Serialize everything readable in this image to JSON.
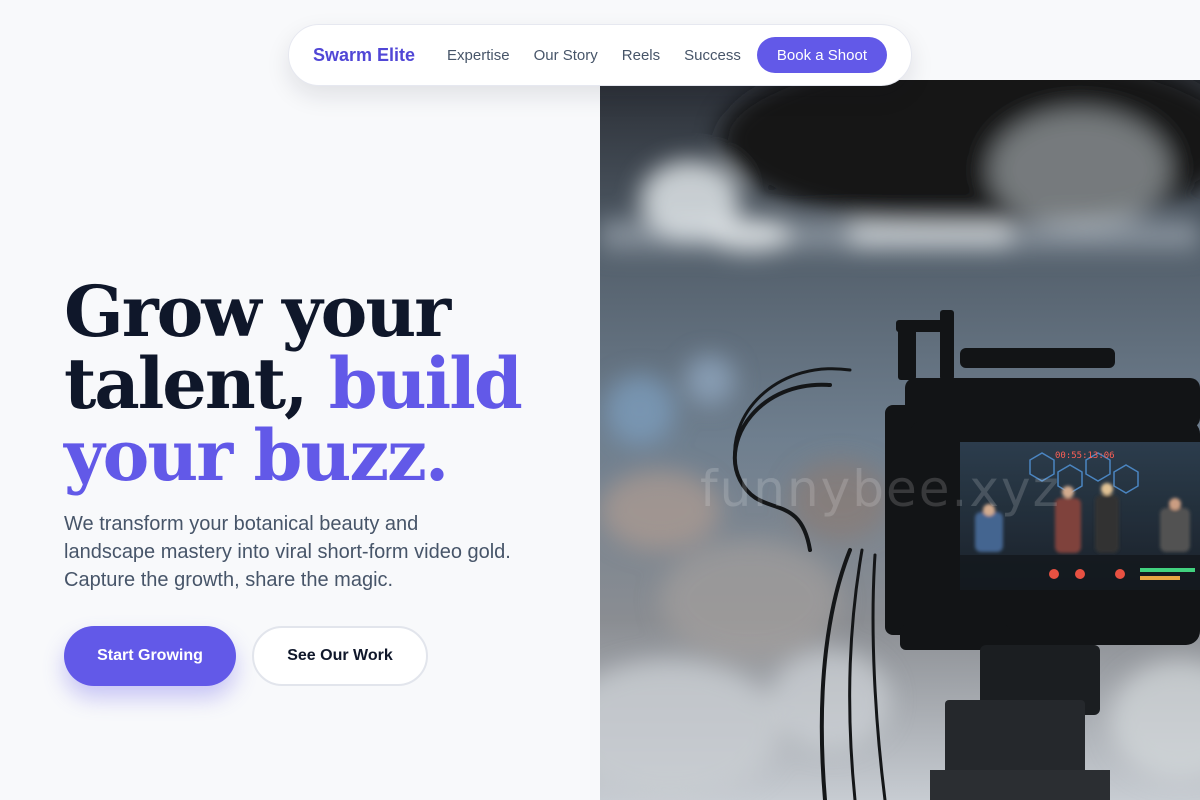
{
  "nav": {
    "brand": "Swarm Elite",
    "links": [
      "Expertise",
      "Our Story",
      "Reels",
      "Success"
    ],
    "cta": "Book a Shoot"
  },
  "hero": {
    "headline_line1": "Grow your",
    "headline_line2a": "talent, ",
    "headline_line2b": "build",
    "headline_line3": "your buzz.",
    "subtext": "We transform your botanical beauty and landscape mastery into viral short-form video gold. Capture the growth, share the magic.",
    "primary_cta": "Start Growing",
    "secondary_cta": "See Our Work"
  },
  "image": {
    "watermark": "funnybee.xyz",
    "monitor_timecode": "00:55:13:06",
    "subject": "camera filming a live band performance"
  },
  "colors": {
    "accent": "#6259e8",
    "brand": "#5147d6",
    "heading": "#0f172a",
    "body": "#475569",
    "background": "#f8f9fb"
  }
}
